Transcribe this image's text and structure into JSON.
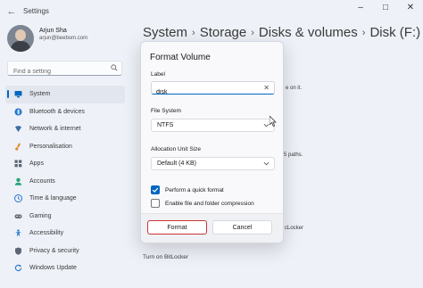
{
  "window": {
    "title": "Settings",
    "back_glyph": "←",
    "minimize_glyph": "–",
    "maximize_glyph": "□",
    "close_glyph": "✕"
  },
  "user": {
    "name": "Arjun Sha",
    "email": "arjun@beebom.com"
  },
  "search": {
    "placeholder": "Find a setting",
    "icon": "search-icon"
  },
  "sidebar": {
    "items": [
      {
        "label": "System",
        "icon": "monitor-icon",
        "active": true,
        "color": "#0067c0"
      },
      {
        "label": "Bluetooth & devices",
        "icon": "bluetooth-icon",
        "active": false,
        "color": "#1f74d0"
      },
      {
        "label": "Network & internet",
        "icon": "network-icon",
        "active": false,
        "color": "#3a6ea5"
      },
      {
        "label": "Personalisation",
        "icon": "brush-icon",
        "active": false,
        "color": "#e08a2c"
      },
      {
        "label": "Apps",
        "icon": "apps-icon",
        "active": false,
        "color": "#5b6675"
      },
      {
        "label": "Accounts",
        "icon": "person-icon",
        "active": false,
        "color": "#2aa37a"
      },
      {
        "label": "Time & language",
        "icon": "globe-clock-icon",
        "active": false,
        "color": "#1f74d0"
      },
      {
        "label": "Gaming",
        "icon": "gamepad-icon",
        "active": false,
        "color": "#666f7c"
      },
      {
        "label": "Accessibility",
        "icon": "accessibility-icon",
        "active": false,
        "color": "#1f74d0"
      },
      {
        "label": "Privacy & security",
        "icon": "shield-icon",
        "active": false,
        "color": "#5b6675"
      },
      {
        "label": "Windows Update",
        "icon": "update-icon",
        "active": false,
        "color": "#1f74d0"
      }
    ]
  },
  "breadcrumb": {
    "items": [
      "System",
      "Storage",
      "Disks & volumes",
      "Disk (F:)"
    ],
    "separator": "›"
  },
  "background": {
    "snippet_1": "e on it.",
    "snippet_2": "5 paths.",
    "snippet_3": "cLocker",
    "snippet_4": "Turn on BitLocker"
  },
  "dialog": {
    "title": "Format Volume",
    "label_caption": "Label",
    "label_value": "disk",
    "clear_glyph": "✕",
    "file_system_caption": "File System",
    "file_system_value": "NTFS",
    "allocation_caption": "Allocation Unit Size",
    "allocation_value": "Default (4 KB)",
    "quick_format_label": "Perform a quick format",
    "quick_format_checked": true,
    "compression_label": "Enable file and folder compression",
    "compression_checked": false,
    "format_button": "Format",
    "cancel_button": "Cancel"
  },
  "colors": {
    "accent": "#0067c0",
    "format_highlight": "#c8353a"
  }
}
